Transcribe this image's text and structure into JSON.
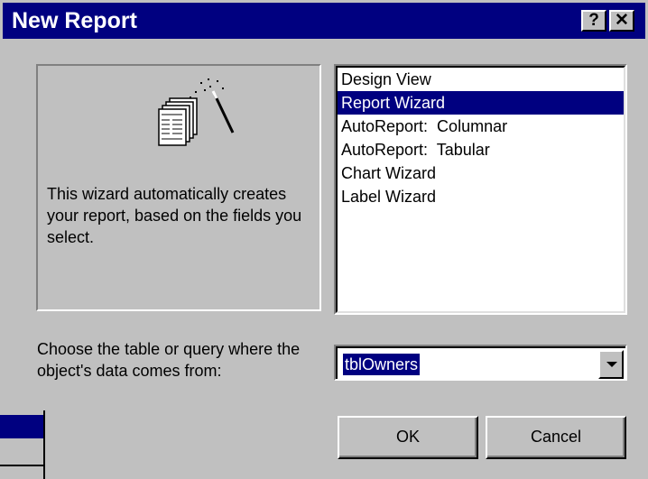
{
  "window": {
    "title": "New Report",
    "help_label": "?",
    "close_label": "✕"
  },
  "preview": {
    "icon": "report-wizard-icon",
    "description": "This wizard automatically creates your report, based on the fields you select."
  },
  "list": {
    "items": [
      {
        "label": "Design View"
      },
      {
        "label": "Report Wizard",
        "selected": true
      },
      {
        "label": "AutoReport:  Columnar"
      },
      {
        "label": "AutoReport:  Tabular"
      },
      {
        "label": "Chart Wizard"
      },
      {
        "label": "Label Wizard"
      }
    ]
  },
  "source": {
    "label": "Choose the table or query where the object's data comes from:",
    "value": "tblOwners"
  },
  "buttons": {
    "ok": "OK",
    "cancel": "Cancel"
  },
  "colors": {
    "face": "#c0c0c0",
    "title_bar": "#000080",
    "selection": "#000080"
  }
}
